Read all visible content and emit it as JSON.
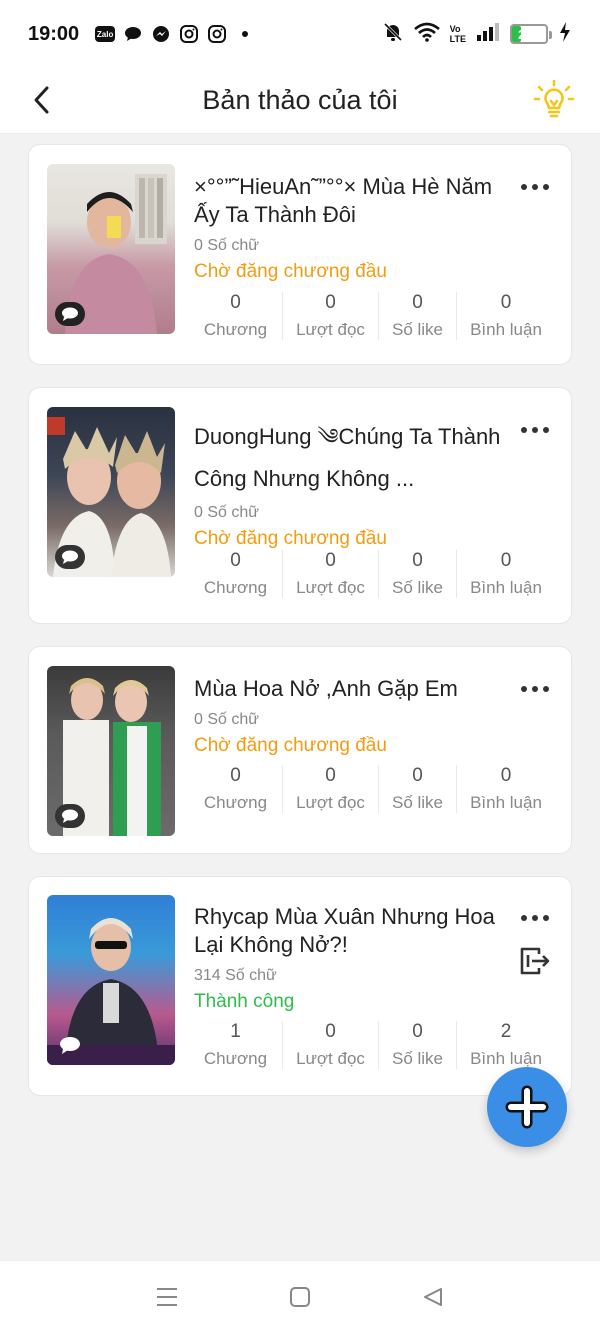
{
  "status_bar": {
    "time": "19:00",
    "notification_icons": [
      "zalo-icon",
      "chat-bubble-icon",
      "messenger-icon",
      "instagram-icon",
      "instagram-icon",
      "dot-icon"
    ],
    "zalo_label": "Zalo",
    "volte_top": "Vo",
    "volte_bottom": "LTE",
    "battery_level": "25",
    "battery_fraction": 0.25
  },
  "app_bar": {
    "title": "Bản thảo của tôi",
    "icons": {
      "back": "chevron-left-icon",
      "tips": "lightbulb-icon"
    }
  },
  "stat_labels": {
    "chapters": "Chương",
    "reads": "Lượt đọc",
    "likes": "Số like",
    "comments": "Bình luận"
  },
  "drafts": [
    {
      "title": "×°°”˜HieuAn˜”°°× Mùa Hè Năm Ấy Ta Thành Đôi",
      "word_count": "0 Số chữ",
      "status": "Chờ đăng chương đầu",
      "stats": {
        "chapters": "0",
        "reads": "0",
        "likes": "0",
        "comments": "0"
      }
    },
    {
      "title": "DuongHung ༄Chúng Ta Thành Công Nhưng Không ...",
      "word_count": "0 Số chữ",
      "status": "Chờ đăng chương đầu",
      "stats": {
        "chapters": "0",
        "reads": "0",
        "likes": "0",
        "comments": "0"
      }
    },
    {
      "title": "Mùa Hoa Nở ,Anh Gặp Em",
      "word_count": "0 Số chữ",
      "status": "Chờ đăng chương đầu",
      "stats": {
        "chapters": "0",
        "reads": "0",
        "likes": "0",
        "comments": "0"
      }
    },
    {
      "title": "Rhycap Mùa Xuân Nhưng Hoa Lại Không Nở?!",
      "word_count": "314 Số chữ",
      "status": "Thành công",
      "stats": {
        "chapters": "1",
        "reads": "0",
        "likes": "0",
        "comments": "2"
      }
    }
  ],
  "colors": {
    "pending_status": "#f39c12",
    "success_status": "#2bbf4a",
    "fab": "#3a8ee6",
    "bulb": "#f5c518"
  },
  "fab_icon": "plus-icon",
  "nav_bar": {
    "icons": [
      "menu-icon",
      "home-square-icon",
      "back-triangle-icon"
    ]
  }
}
